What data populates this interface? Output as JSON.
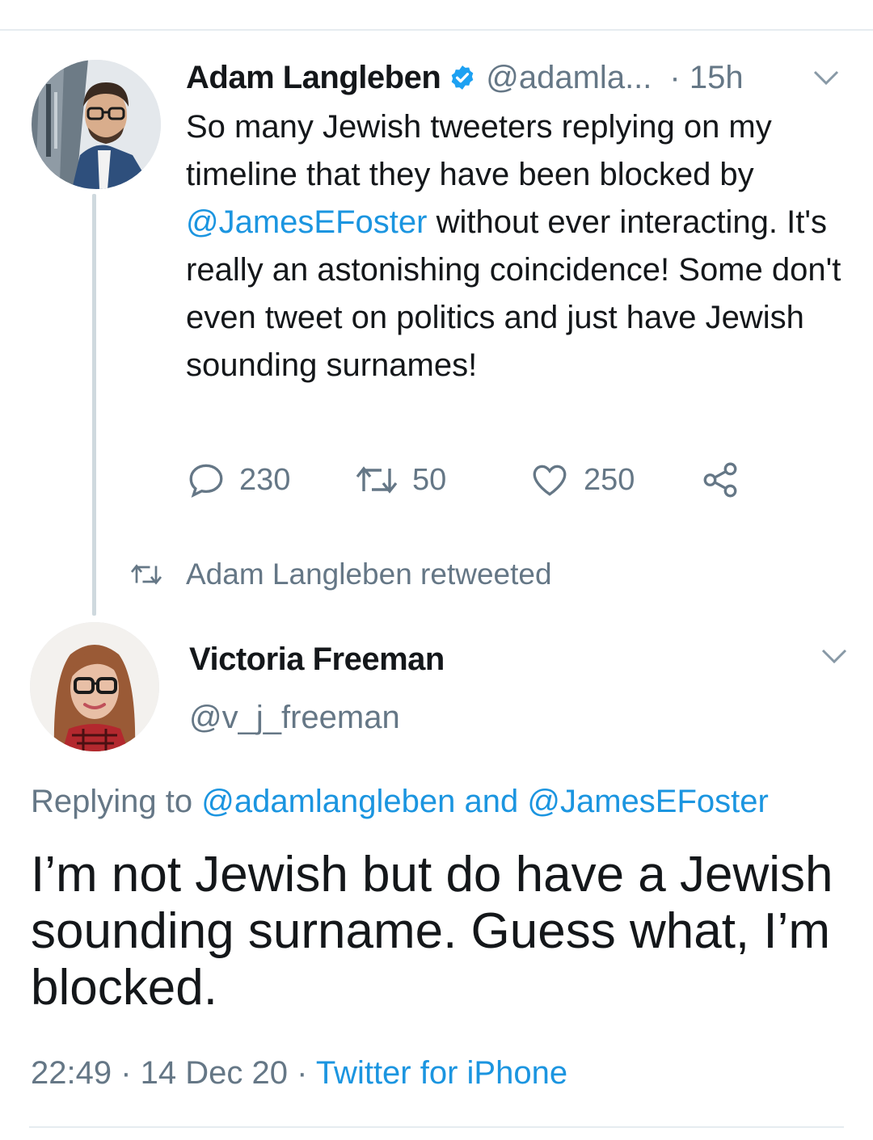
{
  "tweet1": {
    "author_name": "Adam Langleben",
    "handle": "@adamla...",
    "time": "· 15h",
    "text_before": "So many Jewish tweeters replying on my timeline that they have been blocked by ",
    "mention": "@JamesEFoster",
    "text_after": " without ever interacting. It's really an astonishing coincidence! Some don't even tweet on politics and just have Jewish sounding surnames!",
    "counts": {
      "replies": "230",
      "retweets": "50",
      "likes": "250"
    }
  },
  "retweet_label": "Adam Langleben retweeted",
  "tweet2": {
    "author_name": "Victoria Freeman",
    "handle": "@v_j_freeman",
    "replying_prefix": "Replying to ",
    "replying_user1": "@adamlangleben",
    "replying_and": " and ",
    "replying_user2": "@JamesEFoster",
    "text": "I’m not Jewish but do have a Jewish sounding surname. Guess what, I’m blocked.",
    "time": "22:49",
    "sep": " · ",
    "date": "14 Dec 20",
    "source": "Twitter for iPhone"
  },
  "colors": {
    "link": "#1b95e0",
    "muted": "#657786",
    "text": "#14171a",
    "divider": "#e6ecf0"
  },
  "icons": [
    "verified-badge-icon",
    "chevron-down-icon",
    "reply-icon",
    "retweet-icon",
    "like-icon",
    "share-icon"
  ]
}
